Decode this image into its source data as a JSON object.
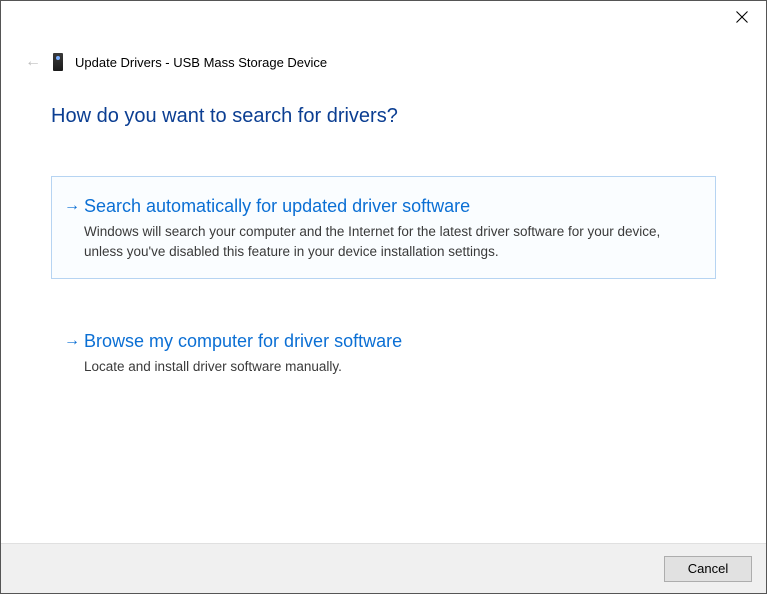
{
  "header": {
    "title": "Update Drivers - USB Mass Storage Device"
  },
  "main": {
    "heading": "How do you want to search for drivers?",
    "options": [
      {
        "title": "Search automatically for updated driver software",
        "description": "Windows will search your computer and the Internet for the latest driver software for your device, unless you've disabled this feature in your device installation settings."
      },
      {
        "title": "Browse my computer for driver software",
        "description": "Locate and install driver software manually."
      }
    ]
  },
  "footer": {
    "cancel_label": "Cancel"
  }
}
